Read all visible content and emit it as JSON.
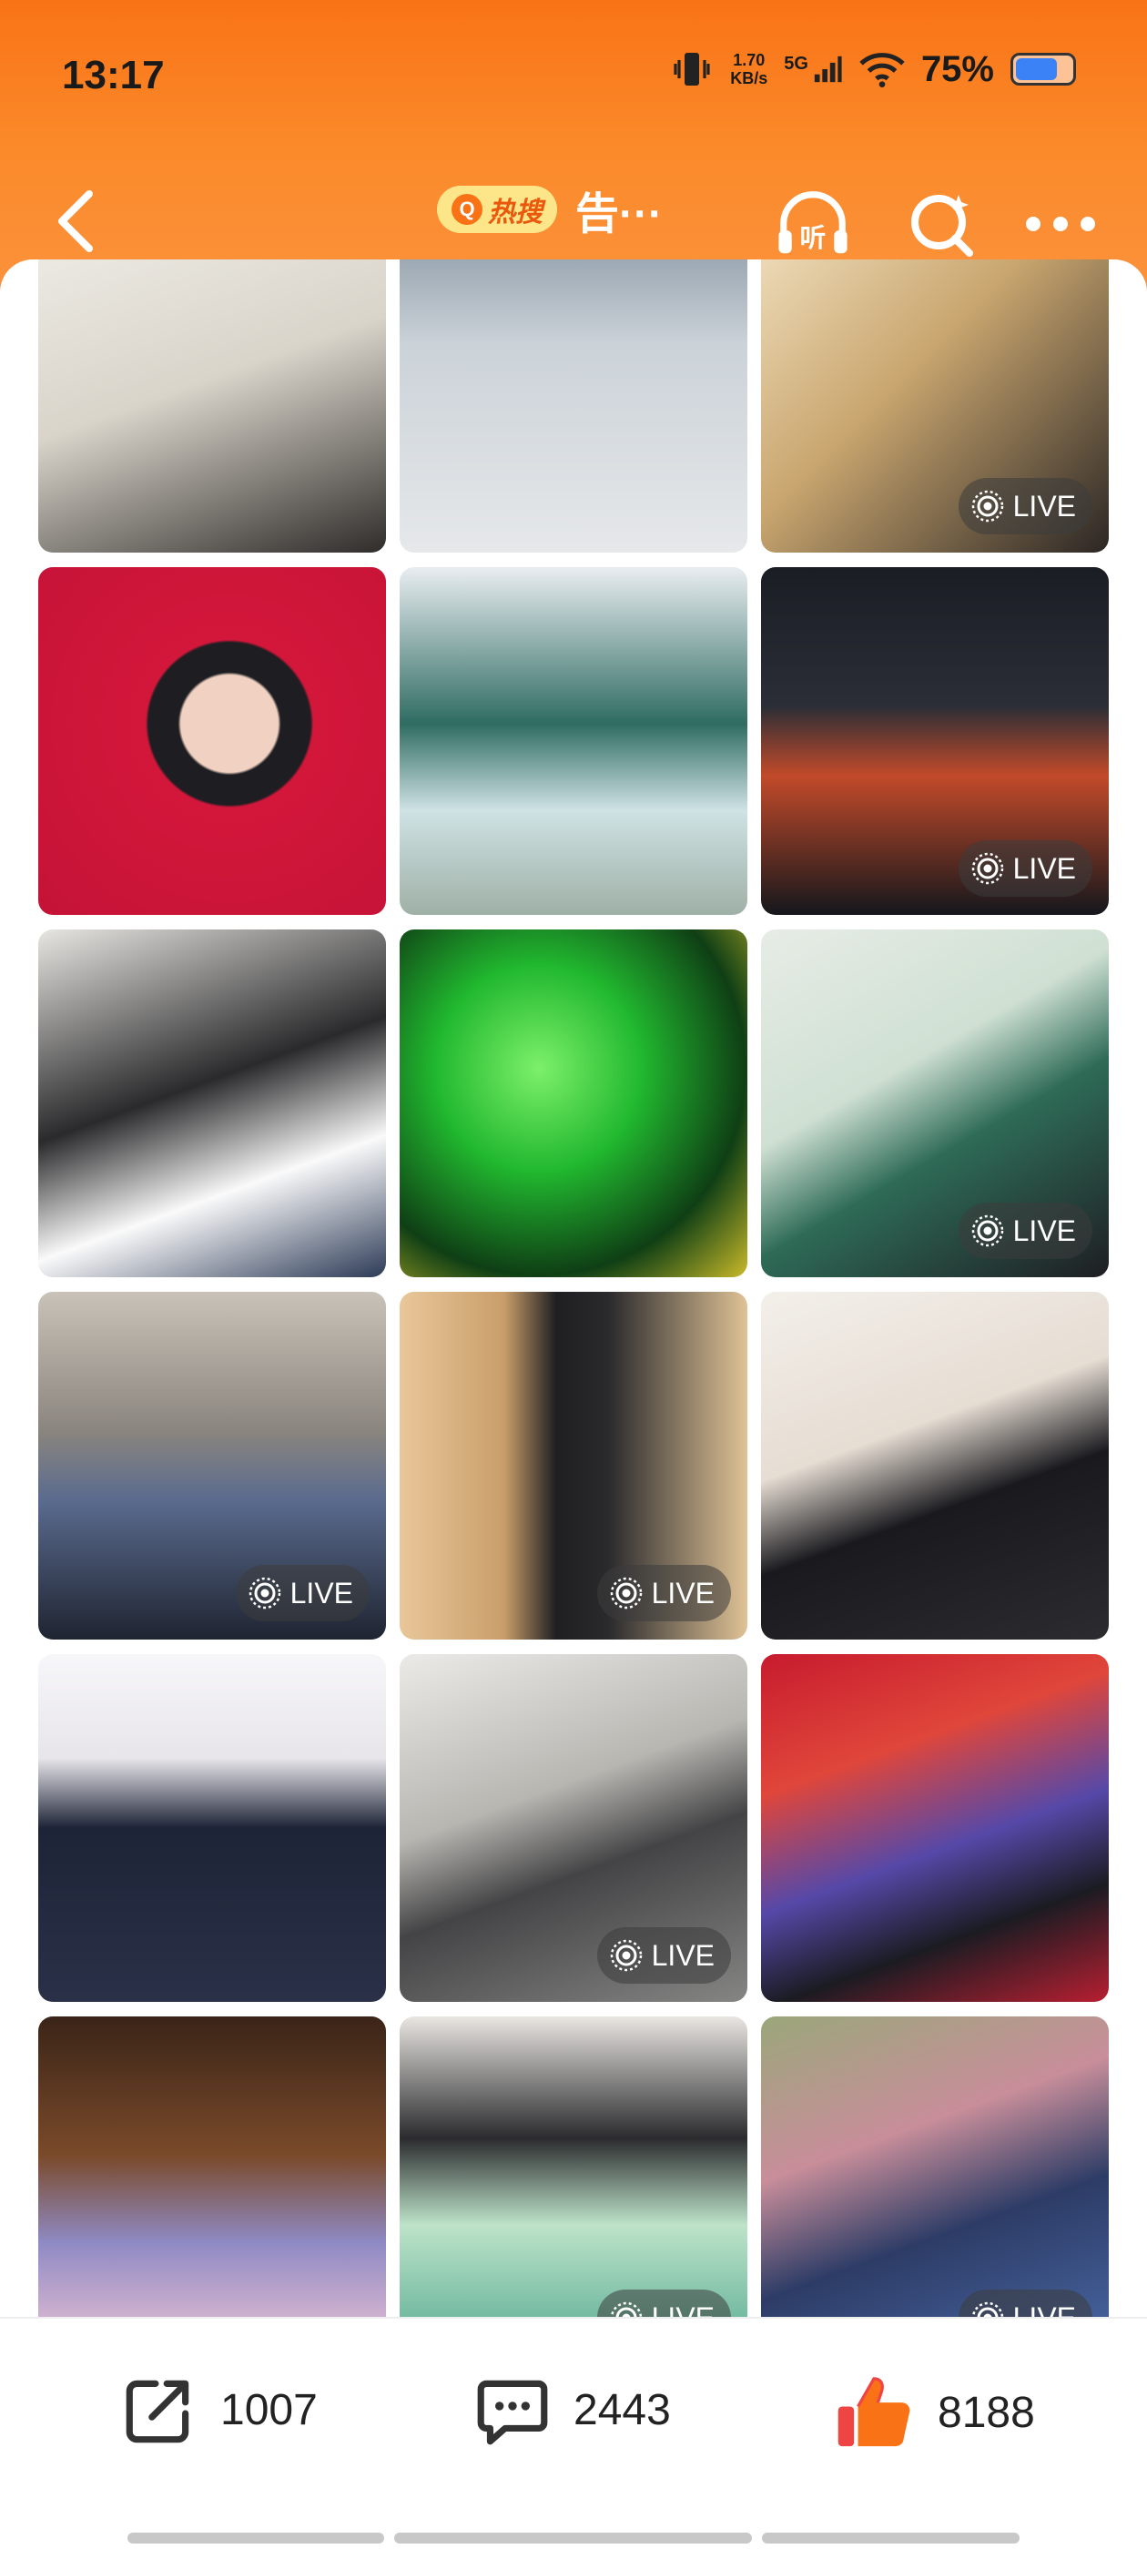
{
  "status_bar": {
    "time": "13:17",
    "net_speed_value": "1.70",
    "net_speed_unit": "KB/s",
    "network": "5G",
    "battery_percent": "75%",
    "battery_level": 0.75
  },
  "nav": {
    "hot_label": "热搜",
    "title": "告···",
    "listen_label": "听"
  },
  "grid": {
    "tiles": [
      {
        "live": false
      },
      {
        "live": false
      },
      {
        "live": true,
        "label": "LIVE"
      },
      {
        "live": false
      },
      {
        "live": false
      },
      {
        "live": true,
        "label": "LIVE"
      },
      {
        "live": false
      },
      {
        "live": false
      },
      {
        "live": true,
        "label": "LIVE"
      },
      {
        "live": true,
        "label": "LIVE"
      },
      {
        "live": true,
        "label": "LIVE"
      },
      {
        "live": false
      },
      {
        "live": false
      },
      {
        "live": true,
        "label": "LIVE"
      },
      {
        "live": false
      },
      {
        "live": false
      },
      {
        "live": true,
        "label": "LIVE"
      },
      {
        "live": true,
        "label": "LIVE"
      }
    ]
  },
  "actions": {
    "share_count": "1007",
    "comment_count": "2443",
    "like_count": "8188"
  },
  "colors": {
    "header": "#f97316",
    "like": "#ef4444"
  }
}
